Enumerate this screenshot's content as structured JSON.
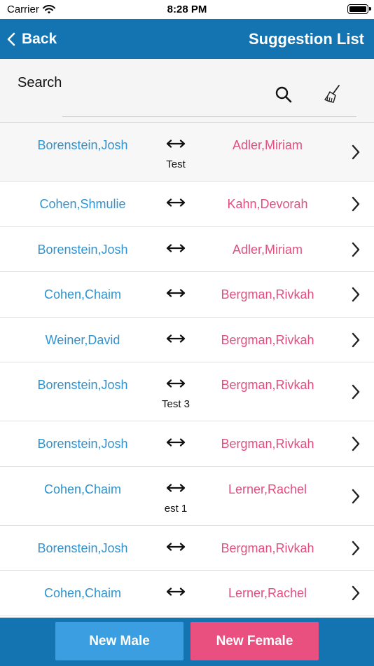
{
  "status_bar": {
    "carrier": "Carrier",
    "time": "8:28 PM"
  },
  "nav": {
    "back_label": "Back",
    "title": "Suggestion List"
  },
  "search": {
    "label": "Search",
    "placeholder": ""
  },
  "rows": [
    {
      "male": "Borenstein,Josh",
      "female": "Adler,Miriam",
      "note": "Test"
    },
    {
      "male": "Cohen,Shmulie",
      "female": "Kahn,Devorah",
      "note": ""
    },
    {
      "male": "Borenstein,Josh",
      "female": "Adler,Miriam",
      "note": ""
    },
    {
      "male": "Cohen,Chaim",
      "female": "Bergman,Rivkah",
      "note": ""
    },
    {
      "male": "Weiner,David",
      "female": "Bergman,Rivkah",
      "note": ""
    },
    {
      "male": "Borenstein,Josh",
      "female": "Bergman,Rivkah",
      "note": "Test 3"
    },
    {
      "male": "Borenstein,Josh",
      "female": "Bergman,Rivkah",
      "note": ""
    },
    {
      "male": "Cohen,Chaim",
      "female": "Lerner,Rachel",
      "note": "est 1"
    },
    {
      "male": "Borenstein,Josh",
      "female": "Bergman,Rivkah",
      "note": ""
    },
    {
      "male": "Cohen,Chaim",
      "female": "Lerner,Rachel",
      "note": ""
    }
  ],
  "footer": {
    "new_male_label": "New Male",
    "new_female_label": "New Female"
  },
  "colors": {
    "nav_blue": "#1474b2",
    "male_text": "#2f93d0",
    "female_text": "#e0507e",
    "male_button": "#3a9ee0",
    "female_button": "#e9507f"
  },
  "icons": {
    "wifi": "wifi-icon",
    "battery": "battery-icon",
    "back": "chevron-left-icon",
    "search": "magnifier-icon",
    "clear": "broom-icon",
    "pair": "double-arrow-icon",
    "disclosure": "chevron-right-icon"
  }
}
